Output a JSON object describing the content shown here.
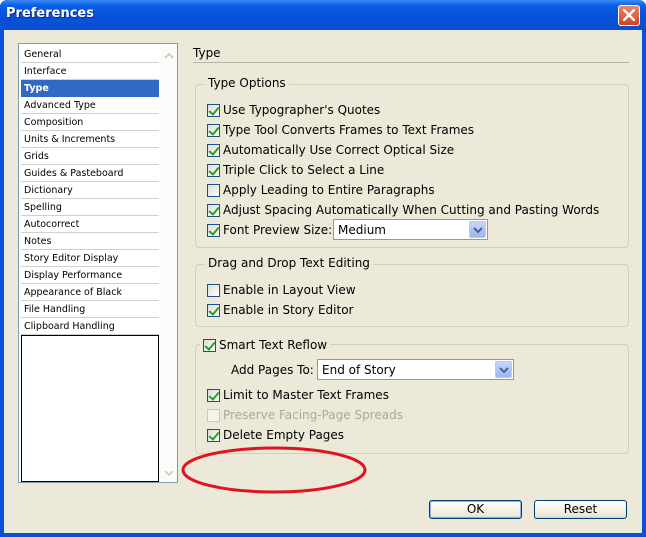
{
  "window": {
    "title": "Preferences"
  },
  "sidebar": {
    "items": [
      "General",
      "Interface",
      "Type",
      "Advanced Type",
      "Composition",
      "Units & Increments",
      "Grids",
      "Guides & Pasteboard",
      "Dictionary",
      "Spelling",
      "Autocorrect",
      "Notes",
      "Story Editor Display",
      "Display Performance",
      "Appearance of Black",
      "File Handling",
      "Clipboard Handling"
    ],
    "selected": "Type"
  },
  "panel": {
    "title": "Type"
  },
  "type_options": {
    "label": "Type Options",
    "items": [
      {
        "label": "Use Typographer's Quotes",
        "checked": true
      },
      {
        "label": "Type Tool Converts Frames to Text Frames",
        "checked": true
      },
      {
        "label": "Automatically Use Correct Optical Size",
        "checked": true
      },
      {
        "label": "Triple Click to Select a Line",
        "checked": true
      },
      {
        "label": "Apply Leading to Entire Paragraphs",
        "checked": false
      },
      {
        "label": "Adjust Spacing Automatically When Cutting and Pasting Words",
        "checked": true
      }
    ],
    "font_preview": {
      "label": "Font Preview Size:",
      "checked": true,
      "value": "Medium"
    }
  },
  "drag_drop": {
    "label": "Drag and Drop Text Editing",
    "items": [
      {
        "label": "Enable in Layout View",
        "checked": false
      },
      {
        "label": "Enable in Story Editor",
        "checked": true
      }
    ]
  },
  "reflow": {
    "label": "Smart Text Reflow",
    "checked": true,
    "add_pages_label": "Add Pages To:",
    "add_pages_value": "End of Story",
    "items": [
      {
        "label": "Limit to Master Text Frames",
        "checked": true,
        "enabled": true
      },
      {
        "label": "Preserve Facing-Page Spreads",
        "checked": false,
        "enabled": false
      },
      {
        "label": "Delete Empty Pages",
        "checked": true,
        "enabled": true
      }
    ]
  },
  "buttons": {
    "ok": "OK",
    "reset": "Reset"
  },
  "colors": {
    "titlebar": "#0a51d9",
    "selection": "#316ac5",
    "annotation": "#e0141e",
    "dialog": "#ece9d8"
  },
  "icons": {
    "close": "close-icon",
    "dropdown": "chevron-down-icon",
    "scroll_down": "scroll-down-arrow-icon"
  }
}
